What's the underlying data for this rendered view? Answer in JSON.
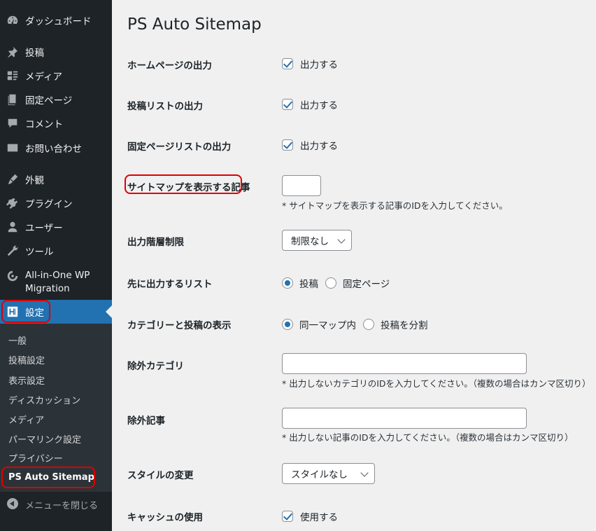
{
  "sidebar": {
    "menu": [
      {
        "label": "ダッシュボード",
        "icon": "dashboard-icon"
      },
      {
        "label": "投稿",
        "icon": "pin-icon"
      },
      {
        "label": "メディア",
        "icon": "media-icon"
      },
      {
        "label": "固定ページ",
        "icon": "page-icon"
      },
      {
        "label": "コメント",
        "icon": "comment-icon"
      },
      {
        "label": "お問い合わせ",
        "icon": "mail-icon"
      },
      {
        "label": "外観",
        "icon": "brush-icon"
      },
      {
        "label": "プラグイン",
        "icon": "plugin-icon"
      },
      {
        "label": "ユーザー",
        "icon": "user-icon"
      },
      {
        "label": "ツール",
        "icon": "wrench-icon"
      },
      {
        "label_line1": "All-in-One WP",
        "label_line2": "Migration",
        "icon": "migration-icon"
      },
      {
        "label": "設定",
        "icon": "settings-icon"
      }
    ],
    "submenu": [
      "一般",
      "投稿設定",
      "表示設定",
      "ディスカッション",
      "メディア",
      "パーマリンク設定",
      "プライバシー",
      "PS Auto Sitemap"
    ],
    "collapse_label": "メニューを閉じる"
  },
  "page": {
    "title": "PS Auto Sitemap",
    "rows": {
      "home": {
        "label": "ホームページの出力",
        "option": "出力する",
        "checked": true
      },
      "post_list": {
        "label": "投稿リストの出力",
        "option": "出力する",
        "checked": true
      },
      "page_list": {
        "label": "固定ページリストの出力",
        "option": "出力する",
        "checked": true
      },
      "sitemap_post": {
        "label": "サイトマップを表示する記事",
        "value": "",
        "help": "* サイトマップを表示する記事のIDを入力してください。"
      },
      "depth": {
        "label": "出力階層制限",
        "selected": "制限なし"
      },
      "first_list": {
        "label": "先に出力するリスト",
        "opt1": "投稿",
        "opt2": "固定ページ",
        "selected": 1
      },
      "cat_display": {
        "label": "カテゴリーと投稿の表示",
        "opt1": "同一マップ内",
        "opt2": "投稿を分割",
        "selected": 1
      },
      "exclude_cat": {
        "label": "除外カテゴリ",
        "value": "",
        "help": "* 出力しないカテゴリのIDを入力してください。（複数の場合はカンマ区切り）"
      },
      "exclude_post": {
        "label": "除外記事",
        "value": "",
        "help": "* 出力しない記事のIDを入力してください。（複数の場合はカンマ区切り）"
      },
      "style": {
        "label": "スタイルの変更",
        "selected": "スタイルなし"
      },
      "cache": {
        "label": "キャッシュの使用",
        "option": "使用する",
        "checked": true
      }
    }
  },
  "colors": {
    "accent": "#2271b1",
    "sidebar_bg": "#1d2327",
    "highlight": "#e00000"
  }
}
